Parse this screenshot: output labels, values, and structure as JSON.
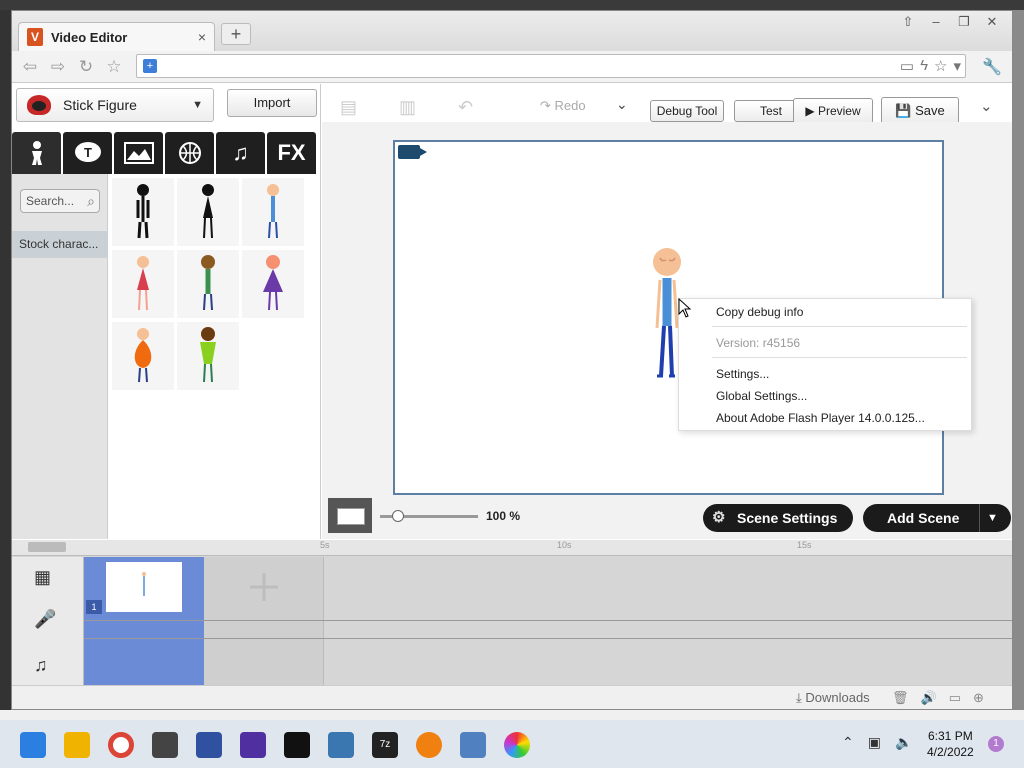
{
  "browser": {
    "tab_title": "Video Editor",
    "tab_icon_letter": "V",
    "tab_close": "×",
    "new_tab": "+",
    "window_controls": [
      "⇧",
      "–",
      "❐",
      "✕"
    ]
  },
  "editor": {
    "character_select": "Stick Figure",
    "import_label": "Import",
    "category_tabs": [
      "person-icon",
      "text-icon",
      "scene-icon",
      "ball-icon",
      "music-icon",
      "FX"
    ],
    "fx_label": "FX",
    "search_placeholder": "Search...",
    "sidebar_item": "Stock charac...",
    "toolbar": {
      "redo_label": "Redo",
      "debug_tool_label": "Debug Tool",
      "test_label": "Test",
      "preview_label": "Preview",
      "save_label": "Save"
    },
    "context_menu": {
      "copy_debug": "Copy debug info",
      "version": "Version: r45156",
      "settings": "Settings...",
      "global_settings": "Global Settings...",
      "about": "About Adobe Flash Player 14.0.0.125..."
    },
    "zoom_value": "100 %",
    "scene_settings_label": "Scene Settings",
    "add_scene_label": "Add Scene",
    "timeline": {
      "ruler_labels": [
        "5s",
        "10s",
        "15s"
      ],
      "scene_number": "1"
    }
  },
  "statusbar": {
    "downloads_label": "Downloads"
  },
  "taskbar": {
    "time": "6:31 PM",
    "date": "4/2/2022",
    "notification_count": "1"
  },
  "colors": {
    "timeline_selected": "#6b8bd6",
    "stage_border": "#5c7fa3",
    "tab_icon": "#d8531f"
  }
}
